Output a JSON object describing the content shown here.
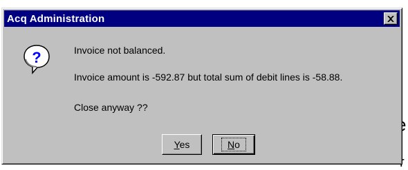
{
  "background": {
    "glyph_top": "e",
    "glyph_bottom": "r"
  },
  "dialog": {
    "title": "Acq Administration",
    "close_icon": "close-icon",
    "message_icon": "question-icon",
    "messages": [
      "Invoice not balanced.",
      "Invoice amount is -592.87 but total sum of debit lines is -58.88.",
      "Close anyway ??"
    ],
    "buttons": {
      "yes_mnemonic": "Y",
      "yes_rest": "es",
      "no_mnemonic": "N",
      "no_rest": "o"
    },
    "colors": {
      "titlebar": "#000080",
      "face": "#c0c0c0",
      "icon_fill": "#ffffff",
      "icon_mark": "#0000ff"
    }
  }
}
